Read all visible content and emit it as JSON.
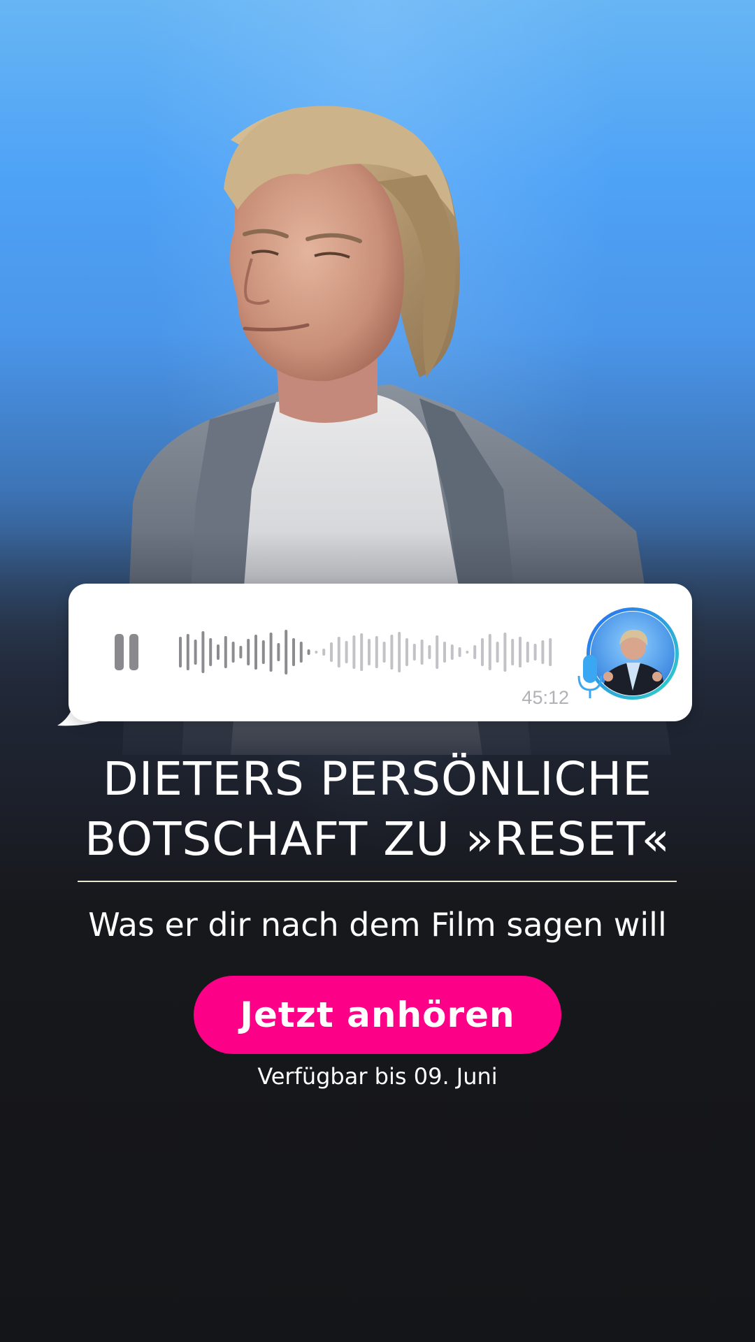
{
  "voice_message": {
    "duration": "45:12",
    "state": "playing",
    "play_pause_icon": "pause-icon",
    "mic_icon": "microphone-icon",
    "accent_color": "#29a8f0"
  },
  "headline": {
    "line1": "DIETERS PERSÖNLICHE",
    "line2": "BOTSCHAFT ZU »RESET«"
  },
  "subtitle": "Was er dir nach dem Film sagen will",
  "cta": {
    "label": "Jetzt anhören",
    "color": "#fc0088"
  },
  "availability": "Verfügbar bis 09. Juni",
  "colors": {
    "background_top": "#4ea2f6",
    "background_bottom": "#141518",
    "divider": "#eae6cf"
  }
}
